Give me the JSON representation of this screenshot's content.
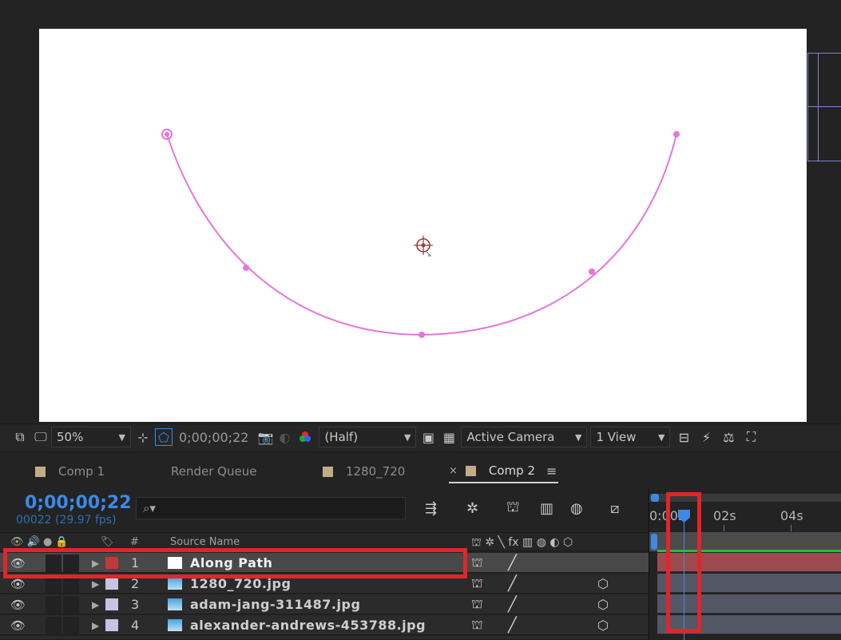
{
  "viewer": {
    "motion_path_color": "#e674dc",
    "zoom": "50%",
    "timecode": "0;00;00;22",
    "resolution": "(Half)",
    "camera": "Active Camera",
    "view_layout": "1 View"
  },
  "tabs": [
    {
      "label": "Comp 1",
      "has_swatch": true
    },
    {
      "label": "Render Queue",
      "has_swatch": false
    },
    {
      "label": "1280_720",
      "has_swatch": true
    },
    {
      "label": "Comp 2",
      "has_swatch": true,
      "active": true,
      "close": "×",
      "menu": "≡"
    }
  ],
  "timeline": {
    "current_time": "0;00;00;22",
    "frame_info": "00022 (29.97 fps)",
    "search_icon_glyph": "⌕▾",
    "column_hash": "#",
    "column_source": "Source Name",
    "ruler_labels": [
      "0:00s",
      "02s",
      "04s"
    ],
    "layers": [
      {
        "num": "1",
        "name": "Along Path",
        "label_color": "#c0393a",
        "source_type": "solid",
        "selected": true
      },
      {
        "num": "2",
        "name": "1280_720.jpg",
        "label_color": "#c7c3e5",
        "source_type": "image"
      },
      {
        "num": "3",
        "name": "adam-jang-311487.jpg",
        "label_color": "#c7c3e5",
        "source_type": "image"
      },
      {
        "num": "4",
        "name": "alexander-andrews-453788.jpg",
        "label_color": "#c7c3e5",
        "source_type": "image"
      }
    ]
  },
  "colors": {
    "accent_blue": "#3c8ae6",
    "highlight_red": "#e2252b",
    "track_green": "#2ebd2e"
  }
}
